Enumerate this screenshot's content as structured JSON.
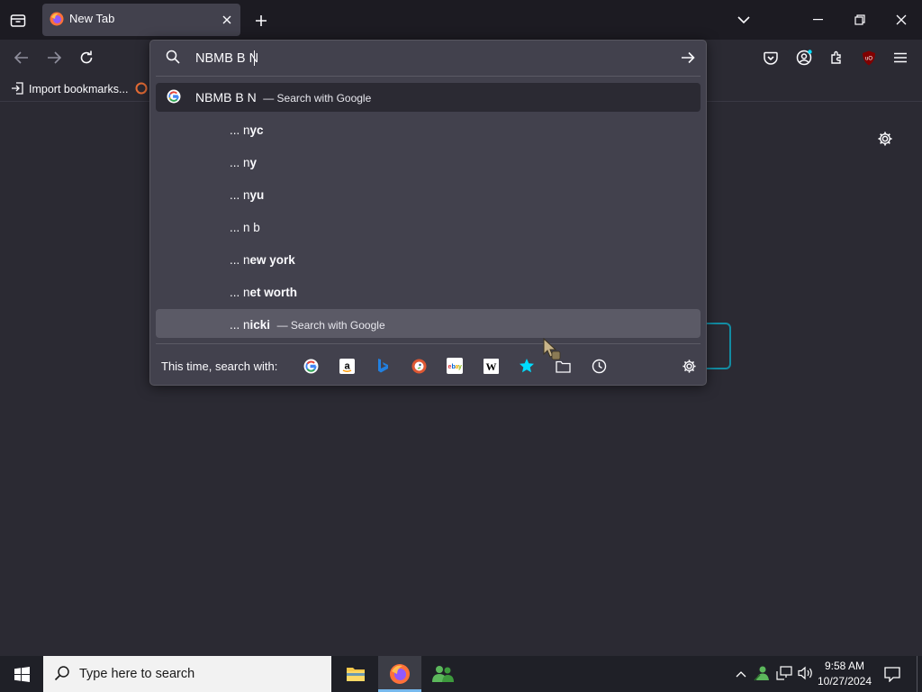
{
  "browser": {
    "tab": {
      "label": "New Tab"
    },
    "bookmarks_bar": {
      "import_label": "Import bookmarks..."
    }
  },
  "urlbar": {
    "value": "NBMB B N",
    "heuristic": {
      "text": "NBMB B N",
      "action": "— Search with Google"
    },
    "suggestions": [
      {
        "prefix": "... n",
        "bold": "yc",
        "action": ""
      },
      {
        "prefix": "... n",
        "bold": "y",
        "action": ""
      },
      {
        "prefix": "... n",
        "bold": "yu",
        "action": ""
      },
      {
        "prefix": "... n b",
        "bold": "",
        "action": ""
      },
      {
        "prefix": "... n",
        "bold": "ew york",
        "action": ""
      },
      {
        "prefix": "... n",
        "bold": "et worth",
        "action": ""
      },
      {
        "prefix": "... n",
        "bold": "icki",
        "action": "— Search with Google"
      }
    ],
    "oneoff": {
      "label": "This time, search with:",
      "engines": [
        "google-icon",
        "amazon-icon",
        "bing-icon",
        "duckduckgo-icon",
        "ebay-icon",
        "wikipedia-icon",
        "bookmarks-star-icon",
        "tabs-icon",
        "history-icon"
      ]
    }
  },
  "taskbar": {
    "search_placeholder": "Type here to search",
    "time": "9:58 AM",
    "date": "10/27/2024"
  },
  "colors": {
    "accent": "#00ddff",
    "popup_bg": "#42414d",
    "content_bg": "#2b2a33",
    "ublock": "#800000"
  }
}
